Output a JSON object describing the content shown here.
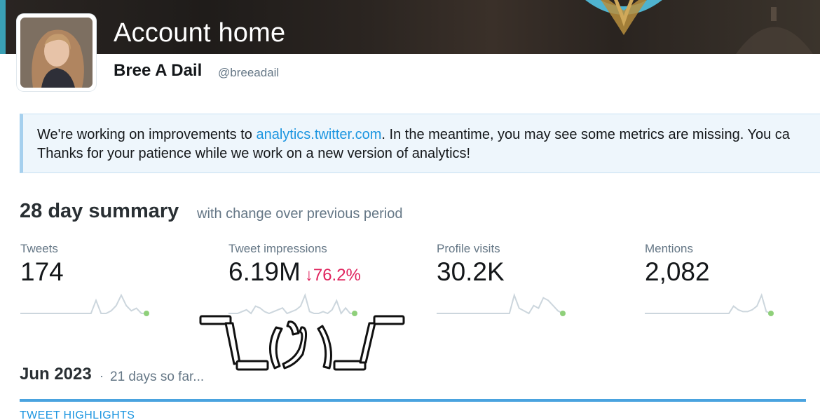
{
  "header": {
    "title": "Account home",
    "user_name": "Bree A Dail",
    "user_handle": "@breeadail"
  },
  "notice": {
    "line1_before": "We're working on improvements to ",
    "line1_link": "analytics.twitter.com",
    "line1_after": ". In the meantime, you may see some metrics are missing. You ca",
    "line2": "Thanks for your patience while we work on a new version of analytics!"
  },
  "summary": {
    "title": "28 day summary",
    "subtitle": "with change over previous period",
    "metrics": [
      {
        "label": "Tweets",
        "value": "174",
        "change": "",
        "sparkline": [
          0,
          0,
          0,
          0,
          0,
          0,
          0,
          0,
          0,
          0,
          0,
          0,
          0,
          0,
          0,
          5,
          0,
          0,
          1,
          3,
          7,
          3,
          1,
          2,
          0,
          0
        ]
      },
      {
        "label": "Tweet impressions",
        "value": "6.19M",
        "change": "76.2%",
        "change_direction": "down",
        "sparkline": [
          0,
          0,
          0,
          1,
          2,
          0,
          4,
          3,
          1,
          0,
          1,
          2,
          3,
          0,
          1,
          2,
          4,
          10,
          1,
          0,
          0,
          1,
          0,
          2,
          7,
          0,
          3,
          0,
          0
        ]
      },
      {
        "label": "Profile visits",
        "value": "30.2K",
        "change": "",
        "sparkline": [
          0,
          0,
          0,
          0,
          0,
          0,
          0,
          0,
          0,
          0,
          0,
          0,
          0,
          0,
          0,
          0,
          7,
          2,
          1,
          0,
          3,
          2,
          6,
          5,
          3,
          1,
          0
        ]
      },
      {
        "label": "Mentions",
        "value": "2,082",
        "change": "",
        "sparkline": [
          0,
          0,
          0,
          0,
          0,
          0,
          0,
          0,
          0,
          0,
          0,
          0,
          0,
          0,
          0,
          0,
          0,
          0,
          0,
          4,
          2,
          1,
          1,
          2,
          4,
          10,
          1,
          0
        ]
      }
    ],
    "spark_color": "#ccd6dd",
    "spark_end_color": "#8fd07a",
    "negative_color": "#e0245e"
  },
  "month": {
    "title": "Jun 2023",
    "separator": "·",
    "subtitle": "21 days so far..."
  },
  "tabs": {
    "highlights": "TWEET HIGHLIGHTS"
  },
  "colors": {
    "link": "#1b95e0",
    "accent_rule": "#4aa3df"
  }
}
